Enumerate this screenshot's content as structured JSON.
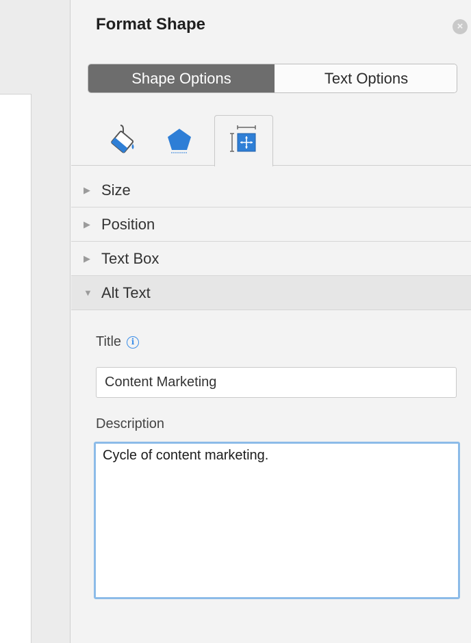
{
  "pane": {
    "title": "Format Shape",
    "tabs": [
      {
        "label": "Shape Options",
        "active": true
      },
      {
        "label": "Text Options",
        "active": false
      }
    ],
    "icon_tabs": [
      {
        "icon": "fill-line-icon",
        "selected": false
      },
      {
        "icon": "effects-pentagon-icon",
        "selected": false
      },
      {
        "icon": "size-properties-icon",
        "selected": true
      }
    ],
    "sections": [
      {
        "label": "Size",
        "expanded": false
      },
      {
        "label": "Position",
        "expanded": false
      },
      {
        "label": "Text Box",
        "expanded": false
      },
      {
        "label": "Alt Text",
        "expanded": true
      }
    ],
    "alt_text": {
      "title_label": "Title",
      "title_value": "Content Marketing",
      "description_label": "Description",
      "description_value": "Cycle of content marketing."
    }
  },
  "colors": {
    "active_tab_bg": "#6d6d6d",
    "focus_ring": "#8cbbe8",
    "info_blue": "#3b8ee8"
  }
}
